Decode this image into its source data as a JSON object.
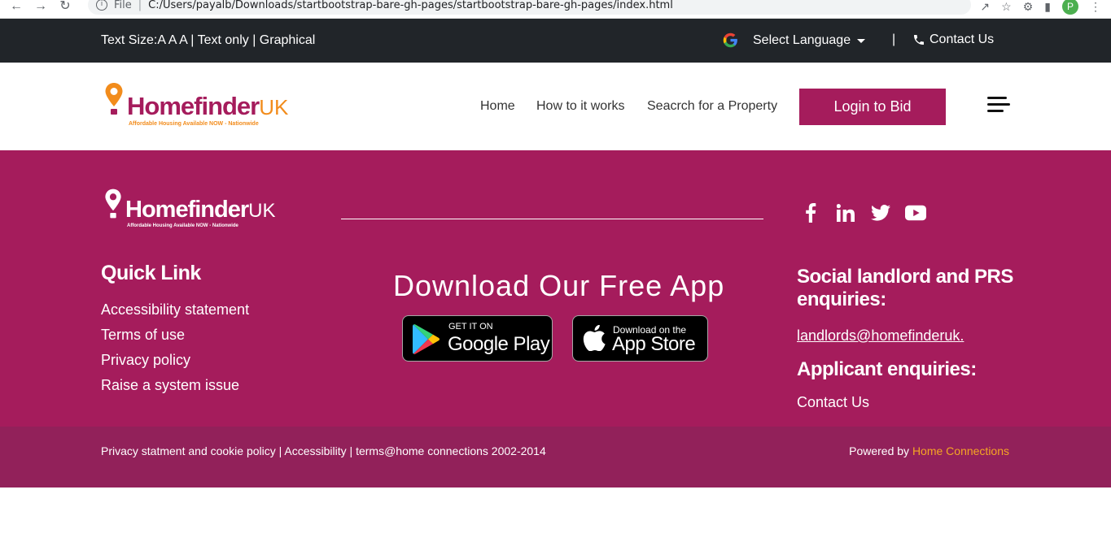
{
  "browser": {
    "scheme": "File",
    "url": "C:/Users/payalb/Downloads/startbootstrap-bare-gh-pages/startbootstrap-bare-gh-pages/index.html",
    "profile_initial": "P"
  },
  "topbar": {
    "text_size_label": "Text Size:A A A | Text only | Graphical",
    "language_label": "Select Language",
    "divider": "|",
    "contact_label": "Contact Us"
  },
  "header": {
    "logo_word": "Homefinder",
    "logo_uk": "UK",
    "logo_tagline": "Affordable Housing Available NOW - Nationwide",
    "nav": {
      "home": "Home",
      "how": "How to it works",
      "search": "Seacrch for a Property"
    },
    "login_label": "Login to Bid"
  },
  "footer": {
    "logo_word": "Homefinder",
    "logo_uk": "UK",
    "logo_tagline": "Affordable Housing Available NOW - Nationwide",
    "quick_title": "Quick Link",
    "quick_links": [
      "Accessibility statement",
      "Terms of use",
      "Privacy policy",
      "Raise a system issue"
    ],
    "app_title": "Download Our Free App",
    "google_small": "GET IT ON",
    "google_big": "Google Play",
    "apple_small": "Download on the",
    "apple_big": "App Store",
    "enq_title": "Social landlord and PRS enquiries:",
    "enq_email": "landlords@homefinderuk.",
    "applicant_title": "Applicant enquiries:",
    "contact_link": "Contact Us",
    "legal": "Privacy statment and cookie policy | Accessibility | terms@home connections 2002-2014",
    "powered_by": "Powered by",
    "powered_company": "Home Connections"
  },
  "colors": {
    "brand": "#a51c5c",
    "brand_dark": "#92215a",
    "accent_orange": "#f28c1c",
    "topbar": "#212529"
  },
  "icons": [
    "back-arrow-icon",
    "forward-arrow-icon",
    "reload-icon",
    "info-icon",
    "share-icon",
    "star-icon",
    "extension-icon",
    "google-icon",
    "caret-down-icon",
    "phone-icon",
    "menu-icon",
    "facebook-icon",
    "linkedin-icon",
    "twitter-icon",
    "youtube-icon",
    "google-play-icon",
    "apple-icon"
  ]
}
